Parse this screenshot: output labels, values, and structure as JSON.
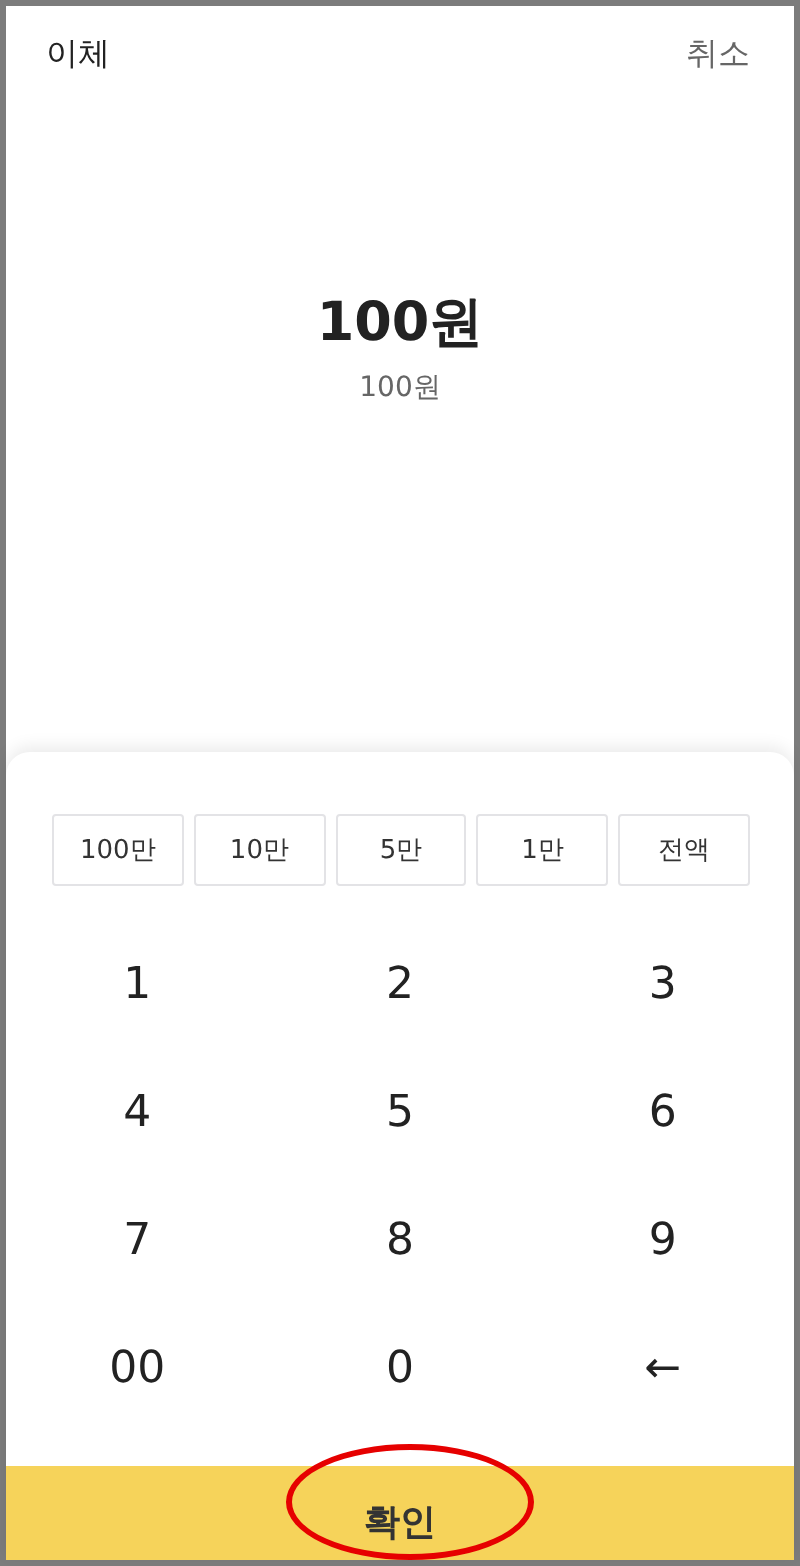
{
  "header": {
    "title": "이체",
    "cancel": "취소"
  },
  "amount": {
    "value": "100원",
    "caption": "100원"
  },
  "quick_amounts": [
    "100만",
    "10만",
    "5만",
    "1만",
    "전액"
  ],
  "keypad": [
    [
      "1",
      "2",
      "3"
    ],
    [
      "4",
      "5",
      "6"
    ],
    [
      "7",
      "8",
      "9"
    ],
    [
      "00",
      "0",
      "←"
    ]
  ],
  "confirm_button": {
    "label": "확인",
    "highlighted": true
  }
}
